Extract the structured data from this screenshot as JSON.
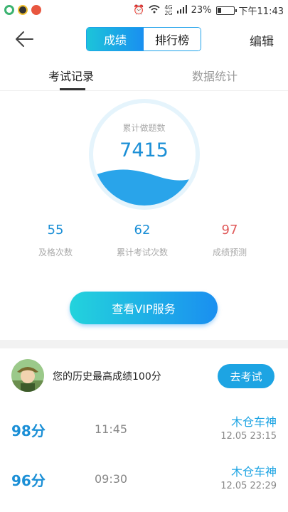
{
  "status_bar": {
    "battery": "23%",
    "time": "下午11:43",
    "network": "4G",
    "network2": "2G"
  },
  "header": {
    "seg_active": "成绩",
    "seg_inactive": "排行榜",
    "edit": "编辑"
  },
  "tabs": {
    "tab1": "考试记录",
    "tab2": "数据统计"
  },
  "gauge": {
    "label": "累计做题数",
    "value": "7415",
    "fill_fraction": 0.3
  },
  "stats": [
    {
      "value": "55",
      "label": "及格次数",
      "color": "#1b8fd6"
    },
    {
      "value": "62",
      "label": "累计考试次数",
      "color": "#1b8fd6"
    },
    {
      "value": "97",
      "label": "成绩预测",
      "color": "#e05a5a"
    }
  ],
  "vip_button": "查看VIP服务",
  "history": {
    "text": "您的历史最高成绩100分",
    "go_exam": "去考试"
  },
  "records": [
    {
      "score": "98分",
      "duration": "11:45",
      "name": "木仓车神",
      "date": "12.05  23:15"
    },
    {
      "score": "96分",
      "duration": "09:30",
      "name": "木仓车神",
      "date": "12.05  22:29"
    }
  ],
  "colors": {
    "accent": "#1da4e3",
    "gauge_ring": "#e5f4fc",
    "gauge_wave": "#29a4ea",
    "predict": "#e05a5a"
  }
}
